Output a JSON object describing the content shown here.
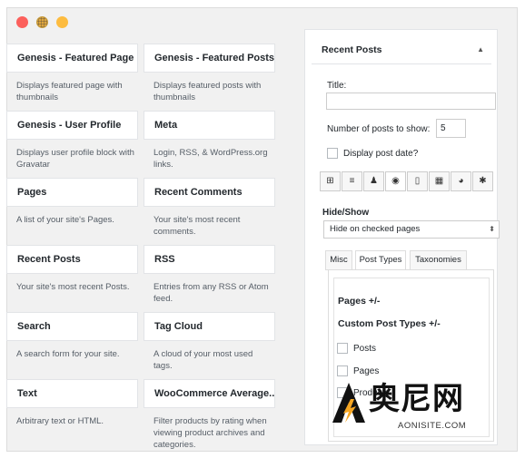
{
  "window": {
    "controls": [
      "close",
      "minimize",
      "maximize"
    ]
  },
  "widgets": [
    {
      "title": "Genesis - Featured Page",
      "desc": "Displays featured page with thumbnails"
    },
    {
      "title": "Genesis - Featured Posts",
      "desc": "Displays featured posts with thumbnails"
    },
    {
      "title": "Genesis - User Profile",
      "desc": "Displays user profile block with Gravatar"
    },
    {
      "title": "Meta",
      "desc": "Login, RSS, & WordPress.org links."
    },
    {
      "title": "Pages",
      "desc": "A list of your site's Pages."
    },
    {
      "title": "Recent Comments",
      "desc": "Your site's most recent comments."
    },
    {
      "title": "Recent Posts",
      "desc": "Your site's most recent Posts."
    },
    {
      "title": "RSS",
      "desc": "Entries from any RSS or Atom feed."
    },
    {
      "title": "Search",
      "desc": "A search form for your site."
    },
    {
      "title": "Tag Cloud",
      "desc": "A cloud of your most used tags."
    },
    {
      "title": "Text",
      "desc": "Arbitrary text or HTML."
    },
    {
      "title": "WooCommerce Average...",
      "desc": "Filter products by rating when viewing product archives and categories."
    }
  ],
  "panel": {
    "header": "Recent Posts",
    "title_label": "Title:",
    "title_value": "",
    "number_label": "Number of posts to show:",
    "number_value": "5",
    "show_date_label": "Display post date?",
    "icon_tabs": [
      "table-icon",
      "align-center-icon",
      "user-icon",
      "eye-icon",
      "phone-icon",
      "calendar-icon",
      "palette-icon",
      "gear-icon"
    ],
    "hide_show_label": "Hide/Show",
    "hide_show_value": "Hide on checked pages",
    "tabs": [
      "Misc",
      "Post Types",
      "Taxonomies"
    ],
    "pages_heading": "Pages +/-",
    "cpt_heading": "Custom Post Types +/-",
    "post_types": [
      "Posts",
      "Pages",
      "Products"
    ]
  },
  "watermark": {
    "text": "奥尼网",
    "sub": "AONISITE.COM"
  }
}
